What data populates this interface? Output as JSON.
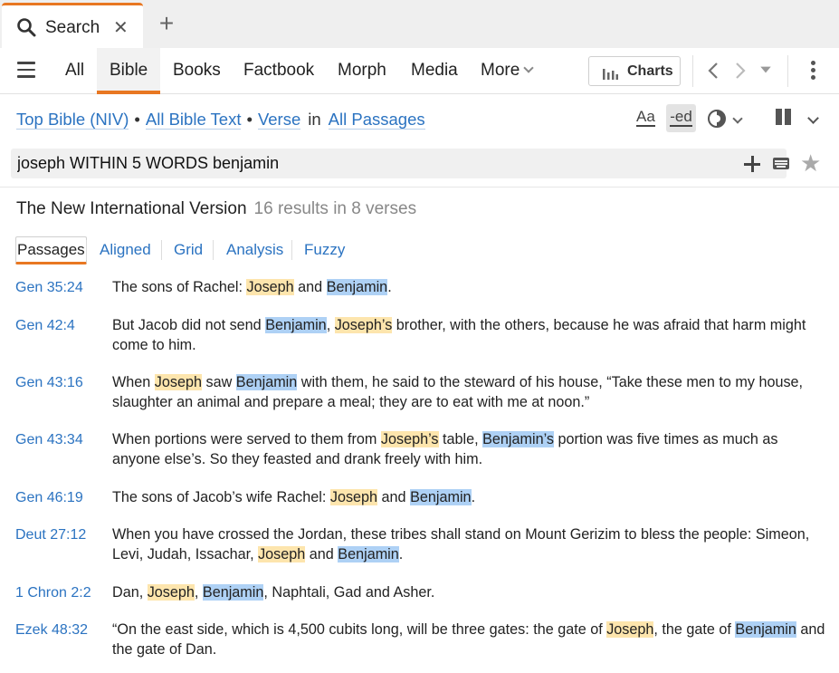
{
  "tab": {
    "title": "Search",
    "close_glyph": "✕",
    "new_glyph": "+",
    "icon": "search-icon"
  },
  "nav": {
    "items": [
      "All",
      "Bible",
      "Books",
      "Factbook",
      "Morph",
      "Media"
    ],
    "active": "Bible",
    "more_label": "More",
    "charts_label": "Charts"
  },
  "scope": {
    "bible": "Top Bible (NIV)",
    "range": "All Bible Text",
    "unit": "Verse",
    "in_word": "in",
    "passages": "All Passages",
    "bullet": "•"
  },
  "toolbar": {
    "font_label": "Aa",
    "ed_label": "-ed"
  },
  "search": {
    "query": "joseph WITHIN 5 WORDS benjamin"
  },
  "results_header": {
    "version": "The New International Version",
    "count": "16 results in 8 verses"
  },
  "subtabs": [
    "Passages",
    "Aligned",
    "Grid",
    "Analysis",
    "Fuzzy"
  ],
  "colors": {
    "accent": "#e87722",
    "link": "#2b73c1",
    "joseph_highlight": "#fde5ad",
    "benjamin_highlight": "#aed1f5"
  },
  "results": [
    {
      "ref": "Gen 35:24",
      "segments": [
        [
          "t",
          "The sons of Rachel: "
        ],
        [
          "j",
          "Joseph"
        ],
        [
          "t",
          " and "
        ],
        [
          "b",
          "Benjamin"
        ],
        [
          "t",
          "."
        ]
      ]
    },
    {
      "ref": "Gen 42:4",
      "segments": [
        [
          "t",
          "But Jacob did not send "
        ],
        [
          "b",
          "Benjamin"
        ],
        [
          "t",
          ", "
        ],
        [
          "j",
          "Joseph’s"
        ],
        [
          "t",
          " brother, with the others, because he was afraid that harm might come to him."
        ]
      ]
    },
    {
      "ref": "Gen 43:16",
      "segments": [
        [
          "t",
          "When "
        ],
        [
          "j",
          "Joseph"
        ],
        [
          "t",
          " saw "
        ],
        [
          "b",
          "Benjamin"
        ],
        [
          "t",
          " with them, he said to the steward of his house, “Take these men to my house, slaughter an animal and prepare a meal; they are to eat with me at noon.”"
        ]
      ]
    },
    {
      "ref": "Gen 43:34",
      "segments": [
        [
          "t",
          "When portions were served to them from "
        ],
        [
          "j",
          "Joseph’s"
        ],
        [
          "t",
          " table, "
        ],
        [
          "b",
          "Benjamin’s"
        ],
        [
          "t",
          " portion was five times as much as anyone else’s. So they feasted and drank freely with him."
        ]
      ]
    },
    {
      "ref": "Gen 46:19",
      "segments": [
        [
          "t",
          "The sons of Jacob’s wife Rachel: "
        ],
        [
          "j",
          "Joseph"
        ],
        [
          "t",
          " and "
        ],
        [
          "b",
          "Benjamin"
        ],
        [
          "t",
          "."
        ]
      ]
    },
    {
      "ref": "Deut 27:12",
      "segments": [
        [
          "t",
          "When you have crossed the Jordan, these tribes shall stand on Mount Gerizim to bless the people: Simeon, Levi, Judah, Issachar, "
        ],
        [
          "j",
          "Joseph"
        ],
        [
          "t",
          " and "
        ],
        [
          "b",
          "Benjamin"
        ],
        [
          "t",
          "."
        ]
      ]
    },
    {
      "ref": "1 Chron 2:2",
      "segments": [
        [
          "t",
          "Dan, "
        ],
        [
          "j",
          "Joseph"
        ],
        [
          "t",
          ", "
        ],
        [
          "b",
          "Benjamin"
        ],
        [
          "t",
          ", Naphtali, Gad and Asher."
        ]
      ]
    },
    {
      "ref": "Ezek 48:32",
      "segments": [
        [
          "t",
          "“On the east side, which is 4,500 cubits long, will be three gates: the gate of "
        ],
        [
          "j",
          "Joseph"
        ],
        [
          "t",
          ", the gate of "
        ],
        [
          "b",
          "Benjamin"
        ],
        [
          "t",
          " and the gate of Dan."
        ]
      ]
    }
  ]
}
